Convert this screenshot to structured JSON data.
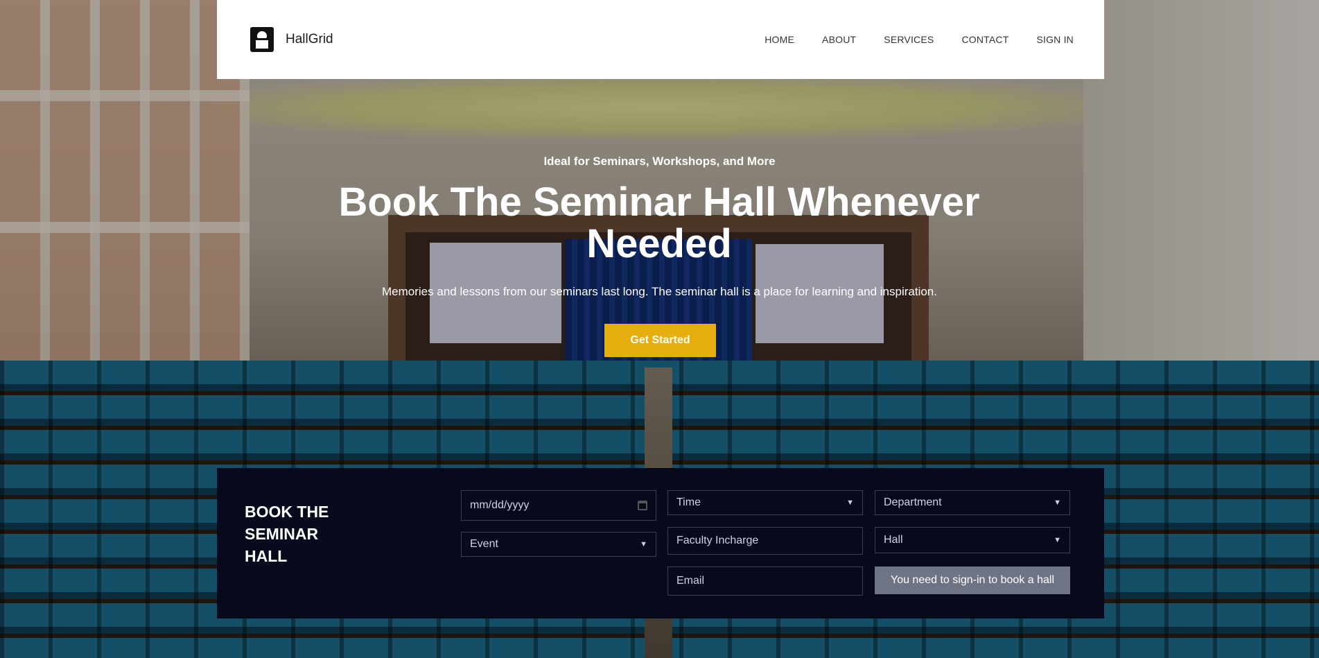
{
  "brand": {
    "name": "HallGrid",
    "logo_icon": "podium-icon"
  },
  "nav": {
    "items": [
      {
        "label": "HOME"
      },
      {
        "label": "ABOUT"
      },
      {
        "label": "SERVICES"
      },
      {
        "label": "CONTACT"
      },
      {
        "label": "SIGN IN"
      }
    ]
  },
  "hero": {
    "kicker": "Ideal for Seminars, Workshops, and More",
    "title": "Book The Seminar Hall Whenever Needed",
    "subtitle": "Memories and lessons from our seminars last long. The seminar hall is a place for learning and inspiration.",
    "cta_label": "Get Started",
    "cta_color": "#e6ad0f"
  },
  "booking": {
    "title": "BOOK THE SEMINAR HALL",
    "date_placeholder": "mm/dd/yyyy",
    "event_label": "Event",
    "time_label": "Time",
    "faculty_placeholder": "Faculty Incharge",
    "email_placeholder": "Email",
    "department_label": "Department",
    "hall_label": "Hall",
    "signin_notice": "You need to sign-in to book a hall",
    "panel_color": "#070a1c"
  }
}
